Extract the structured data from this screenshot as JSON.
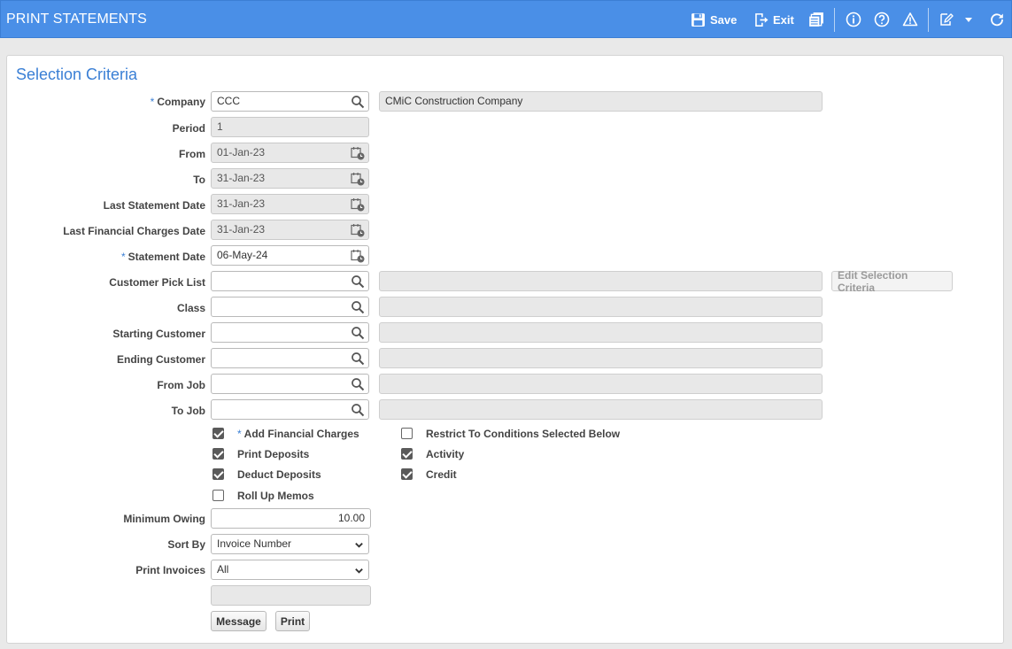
{
  "header": {
    "title": "PRINT STATEMENTS",
    "save_label": "Save",
    "exit_label": "Exit"
  },
  "section": {
    "title": "Selection Criteria"
  },
  "fields": {
    "company": {
      "label": "Company",
      "value": "CCC",
      "description": "CMiC Construction Company"
    },
    "period": {
      "label": "Period",
      "value": "1"
    },
    "from": {
      "label": "From",
      "value": "01-Jan-23"
    },
    "to": {
      "label": "To",
      "value": "31-Jan-23"
    },
    "last_statement_date": {
      "label": "Last Statement Date",
      "value": "31-Jan-23"
    },
    "last_financial_charges_date": {
      "label": "Last Financial Charges Date",
      "value": "31-Jan-23"
    },
    "statement_date": {
      "label": "Statement Date",
      "value": "06-May-24"
    },
    "customer_pick_list": {
      "label": "Customer Pick List",
      "value": "",
      "description": ""
    },
    "class": {
      "label": "Class",
      "value": "",
      "description": ""
    },
    "starting_customer": {
      "label": "Starting Customer",
      "value": "",
      "description": ""
    },
    "ending_customer": {
      "label": "Ending Customer",
      "value": "",
      "description": ""
    },
    "from_job": {
      "label": "From Job",
      "value": "",
      "description": ""
    },
    "to_job": {
      "label": "To Job",
      "value": "",
      "description": ""
    },
    "minimum_owing": {
      "label": "Minimum Owing",
      "value": "10.00"
    },
    "sort_by": {
      "label": "Sort By",
      "value": "Invoice Number"
    },
    "print_invoices": {
      "label": "Print Invoices",
      "value": "All"
    },
    "message_text": ""
  },
  "checkboxes": {
    "add_financial_charges": {
      "label": "Add Financial Charges",
      "checked": true
    },
    "print_deposits": {
      "label": "Print Deposits",
      "checked": true
    },
    "deduct_deposits": {
      "label": "Deduct Deposits",
      "checked": true
    },
    "roll_up_memos": {
      "label": "Roll Up Memos",
      "checked": false
    },
    "restrict_to_conditions": {
      "label": "Restrict To Conditions Selected Below",
      "checked": false
    },
    "activity": {
      "label": "Activity",
      "checked": true
    },
    "credit": {
      "label": "Credit",
      "checked": true
    }
  },
  "buttons": {
    "edit_selection_criteria": "Edit Selection Criteria",
    "message": "Message",
    "print": "Print"
  },
  "icons": {
    "save": "save-icon",
    "exit": "exit-icon",
    "print_preview": "documents-icon",
    "info": "info-icon",
    "help": "help-icon",
    "warning": "warning-icon",
    "edit": "edit-icon",
    "menu": "chevron-down-icon",
    "refresh": "refresh-icon",
    "lookup": "search-icon",
    "calendar": "calendar-icon"
  },
  "colors": {
    "header_bg": "#4a8fe7",
    "accent": "#3a7fd5"
  }
}
